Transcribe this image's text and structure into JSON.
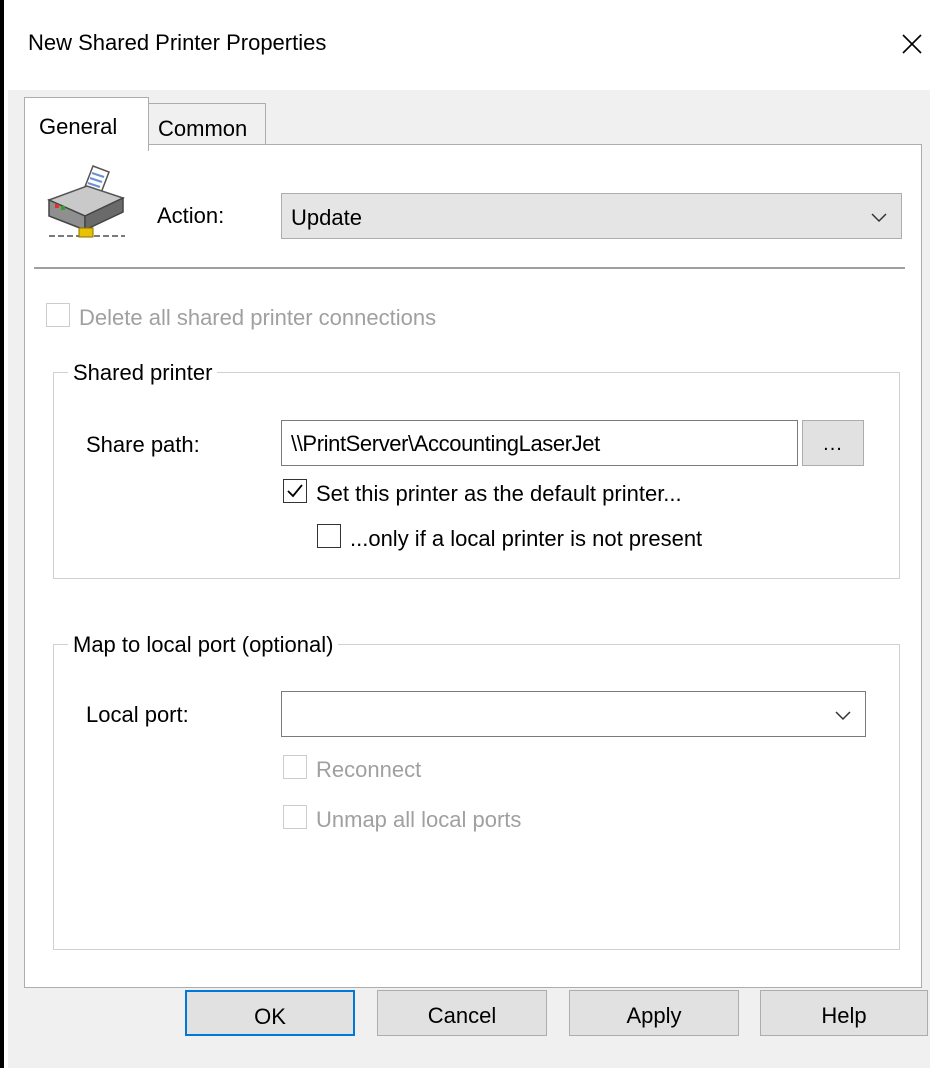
{
  "window": {
    "title": "New Shared Printer Properties"
  },
  "icons": {
    "close": "close-icon",
    "printer": "printer-icon",
    "dropdown": "chevron-down-icon",
    "check": "checkmark-icon"
  },
  "tabs": [
    {
      "label": "General",
      "selected": true
    },
    {
      "label": "Common",
      "selected": false
    }
  ],
  "general": {
    "action_label": "Action:",
    "action_value": "Update",
    "delete_all": {
      "label": "Delete all shared printer connections",
      "checked": false,
      "enabled": false
    },
    "shared_printer": {
      "title": "Shared printer",
      "share_path_label": "Share path:",
      "share_path_value": "\\\\PrintServer\\AccountingLaserJet",
      "browse_label": "...",
      "set_default": {
        "label": "Set this printer as the default printer...",
        "checked": true,
        "enabled": true
      },
      "only_if_local": {
        "label": "...only if a local printer is not present",
        "checked": false,
        "enabled": true
      }
    },
    "map_port": {
      "title": "Map to local port (optional)",
      "local_port_label": "Local port:",
      "local_port_value": "",
      "reconnect": {
        "label": "Reconnect",
        "checked": false,
        "enabled": false
      },
      "unmap_all": {
        "label": "Unmap all local ports",
        "checked": false,
        "enabled": false
      }
    }
  },
  "buttons": {
    "ok": "OK",
    "cancel": "Cancel",
    "apply": "Apply",
    "help": "Help"
  },
  "colors": {
    "accent": "#0078d7",
    "face": "#f0f0f0",
    "disabled_text": "#a0a0a0"
  }
}
